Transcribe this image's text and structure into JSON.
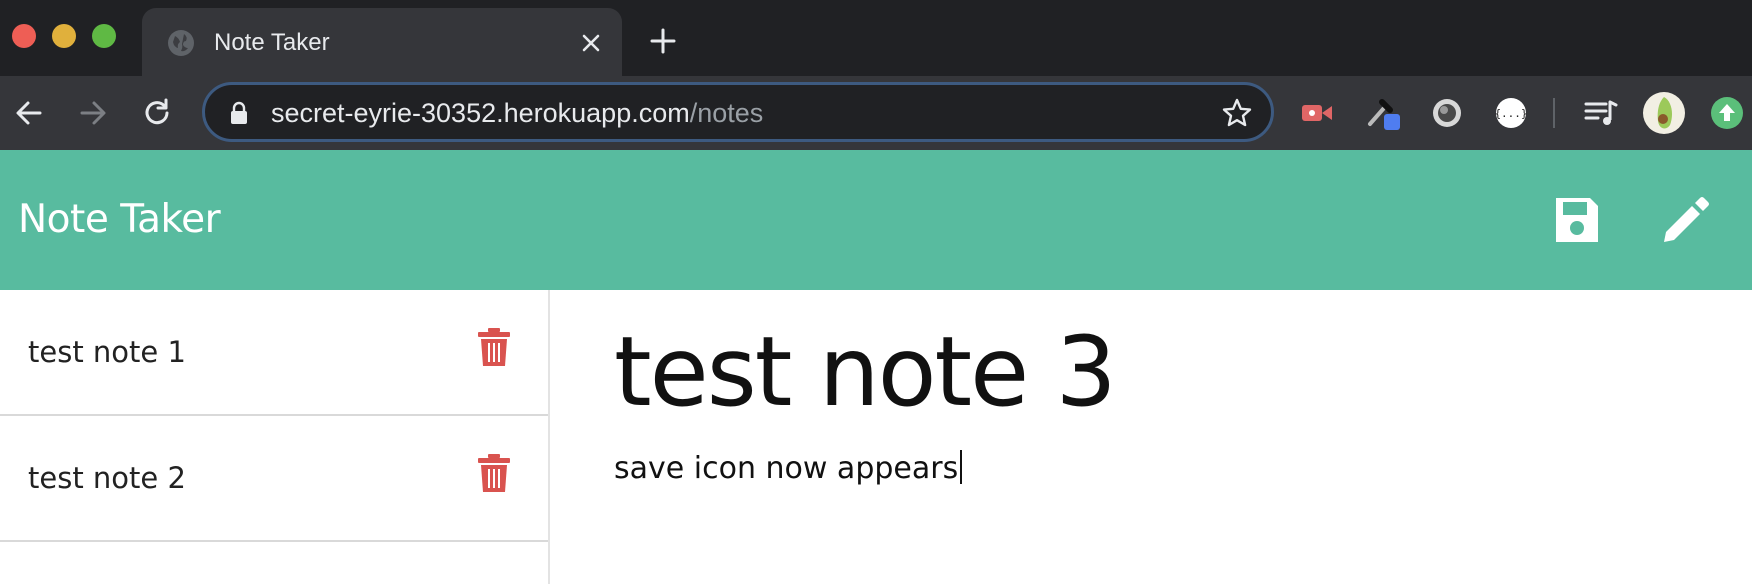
{
  "browser": {
    "tab_title": "Note Taker",
    "url_host": "secret-eyrie-30352.herokuapp.com",
    "url_path": "/notes",
    "icons": [
      "globe-icon",
      "close-icon",
      "plus-icon",
      "back-arrow-icon",
      "forward-arrow-icon",
      "reload-icon",
      "lock-icon",
      "star-icon"
    ],
    "extension_icons": [
      "record-extension-icon",
      "eyedropper-extension-icon",
      "lens-extension-icon",
      "json-extension-icon",
      "media-queue-icon",
      "profile-avatar-icon",
      "update-icon"
    ]
  },
  "app": {
    "title": "Note Taker",
    "header_color": "#58bb9f",
    "header_icons": [
      "save-icon",
      "pencil-icon"
    ]
  },
  "notes": [
    {
      "title": "test note 1"
    },
    {
      "title": "test note 2"
    }
  ],
  "active_note": {
    "title": "test note 3",
    "text": "save icon now appears"
  },
  "colors": {
    "trash": "#d9534f",
    "chrome_dark": "#202124",
    "chrome_toolbar": "#35363a"
  }
}
